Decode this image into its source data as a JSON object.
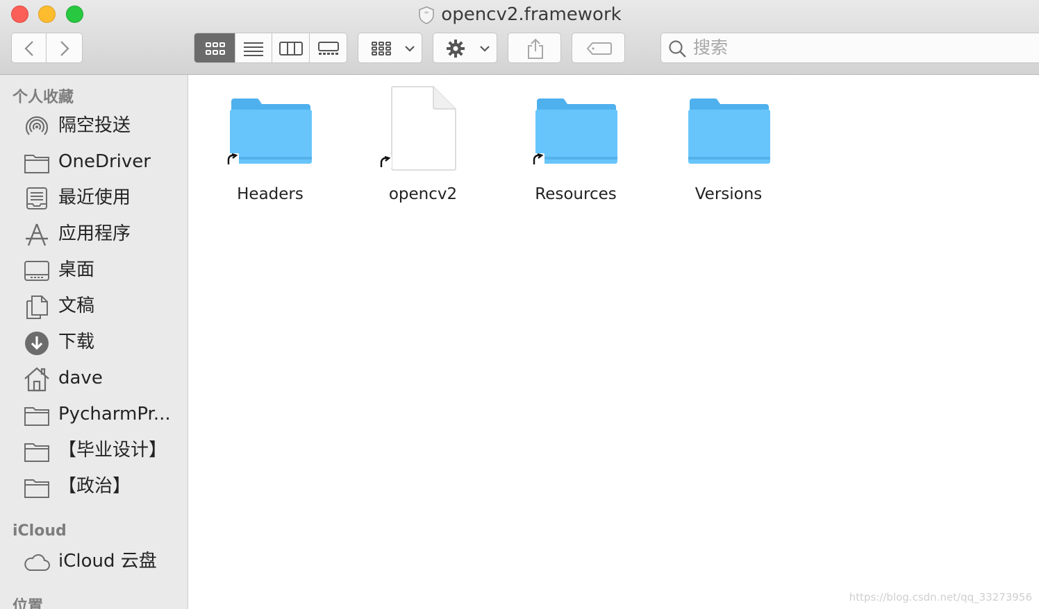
{
  "window": {
    "title": "opencv2.framework"
  },
  "toolbar": {
    "search_placeholder": "搜索"
  },
  "sidebar": {
    "favorites_header": "个人收藏",
    "favorites": [
      {
        "label": "隔空投送",
        "icon": "airdrop-icon"
      },
      {
        "label": "OneDriver",
        "icon": "folder-icon"
      },
      {
        "label": "最近使用",
        "icon": "recents-icon"
      },
      {
        "label": "应用程序",
        "icon": "applications-icon"
      },
      {
        "label": "桌面",
        "icon": "desktop-icon"
      },
      {
        "label": "文稿",
        "icon": "documents-icon"
      },
      {
        "label": "下载",
        "icon": "downloads-icon"
      },
      {
        "label": "dave",
        "icon": "home-icon"
      },
      {
        "label": "PycharmPr...",
        "icon": "folder-icon"
      },
      {
        "label": "【毕业设计】",
        "icon": "folder-icon"
      },
      {
        "label": "【政治】",
        "icon": "folder-icon"
      }
    ],
    "icloud_header": "iCloud",
    "icloud": [
      {
        "label": "iCloud 云盘",
        "icon": "cloud-icon"
      }
    ],
    "locations_header": "位置"
  },
  "files": [
    {
      "name": "Headers",
      "kind": "folder",
      "alias": true
    },
    {
      "name": "opencv2",
      "kind": "document",
      "alias": true
    },
    {
      "name": "Resources",
      "kind": "folder",
      "alias": true
    },
    {
      "name": "Versions",
      "kind": "folder",
      "alias": false
    }
  ],
  "colors": {
    "folder": "#5ebcf6",
    "folder_top": "#4fb0ee",
    "active_view": "#6b6b6b"
  },
  "watermark": "https://blog.csdn.net/qq_33273956"
}
